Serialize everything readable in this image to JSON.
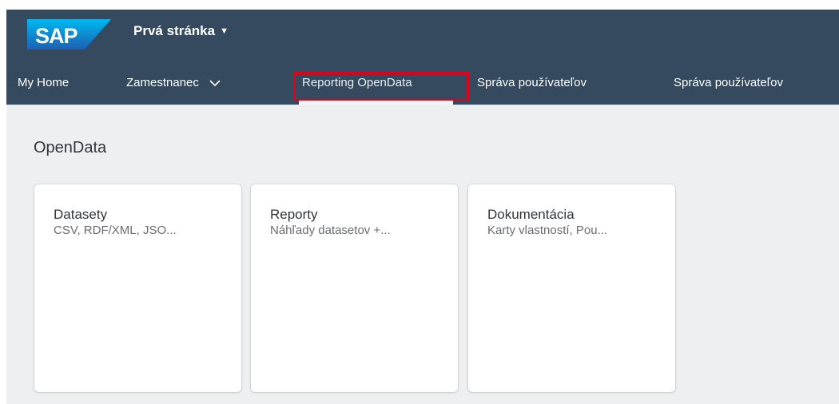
{
  "shell": {
    "logo_text": "SAP",
    "page_title": "Prvá stránka",
    "title_caret": "▼"
  },
  "nav": {
    "items": [
      {
        "label": "My Home"
      },
      {
        "label": "Zamestnanec"
      },
      {
        "label": "Reporting OpenData",
        "active": true
      },
      {
        "label": "Správa používateľov"
      },
      {
        "label": "Správa používateľov"
      }
    ]
  },
  "section": {
    "title": "OpenData"
  },
  "tiles": [
    {
      "title": "Datasety",
      "subtitle": "CSV, RDF/XML, JSO..."
    },
    {
      "title": "Reporty",
      "subtitle": "Náhľady datasetov +..."
    },
    {
      "title": "Dokumentácia",
      "subtitle": "Karty vlastností, Pou..."
    }
  ],
  "colors": {
    "shell_bg": "#354a5f",
    "page_bg": "#edeff0",
    "highlight": "#e0001a",
    "logo_gradient_top": "#00b8f1",
    "logo_gradient_bottom": "#1e5fb3"
  }
}
